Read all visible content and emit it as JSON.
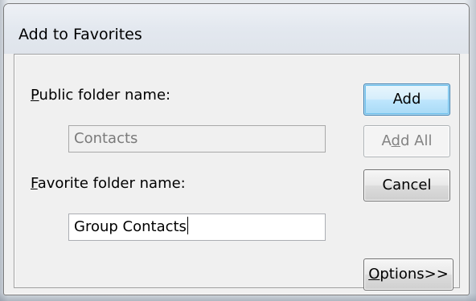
{
  "dialog": {
    "title": "Add to Favorites"
  },
  "public_folder": {
    "label_mnemonic": "P",
    "label_rest": "ublic folder name:",
    "value": "Contacts"
  },
  "favorite_folder": {
    "label_mnemonic": "F",
    "label_rest": "avorite folder name:",
    "value": "Group Contacts"
  },
  "buttons": {
    "add": "Add",
    "add_all_pre": "A",
    "add_all_mnemonic": "d",
    "add_all_post": "d All",
    "cancel": "Cancel",
    "options_mnemonic": "O",
    "options_rest": "ptions>>"
  },
  "colors": {
    "default_button_border": "#3c7fb1",
    "disabled_text": "#7a7a7a"
  }
}
